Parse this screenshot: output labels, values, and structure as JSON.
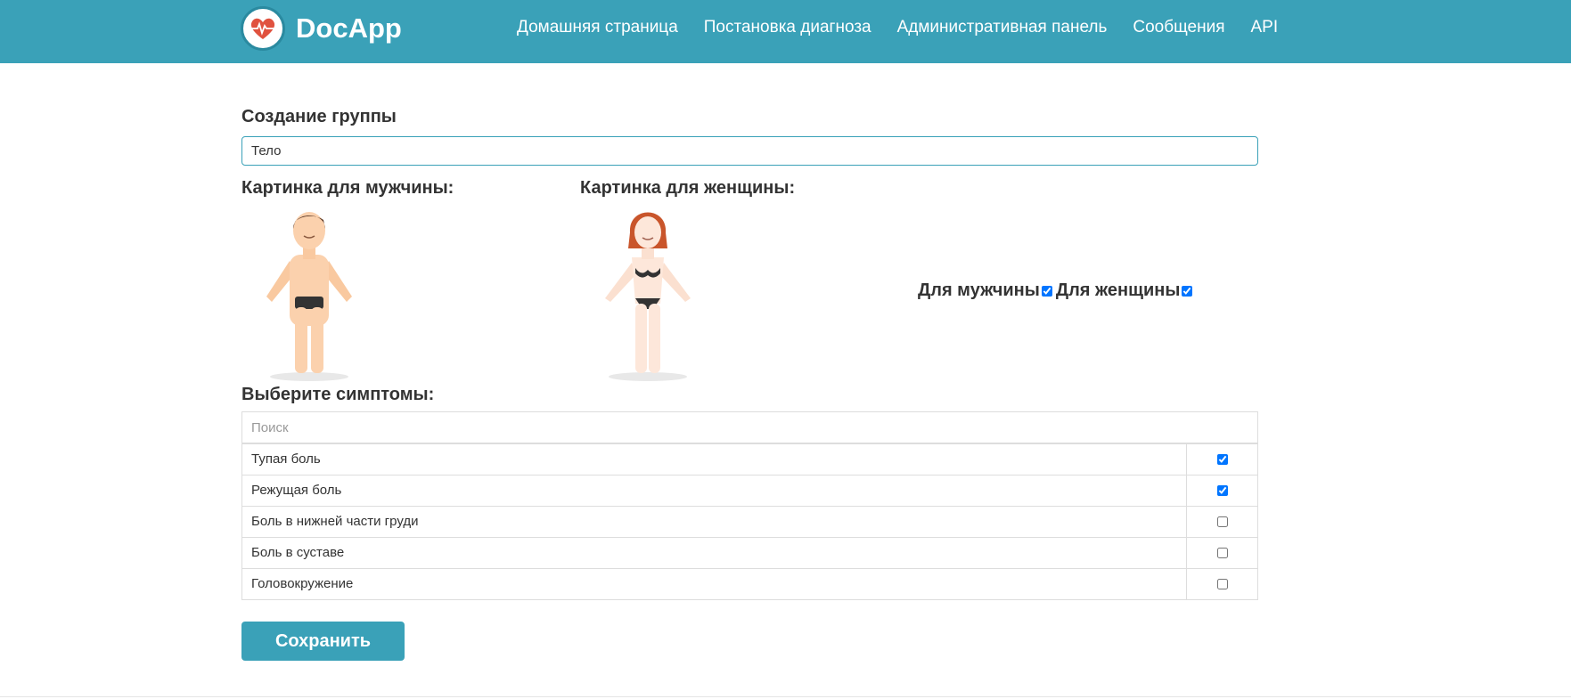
{
  "header": {
    "brand": "DocApp",
    "nav": [
      {
        "label": "Домашняя страница"
      },
      {
        "label": "Постановка диагноза"
      },
      {
        "label": "Административная панель"
      },
      {
        "label": "Сообщения"
      },
      {
        "label": "API"
      }
    ],
    "colors": {
      "navbar": "#3aa1b8",
      "logo_heart": "#e0523f"
    }
  },
  "form": {
    "title": "Создание группы",
    "group_name_value": "Тело",
    "male_image_label": "Картинка для мужчины:",
    "female_image_label": "Картинка для женщины:",
    "for_male_label": "Для мужчины",
    "for_male_checked": true,
    "for_female_label": "Для женщины",
    "for_female_checked": true,
    "symptoms_title": "Выберите симптомы:",
    "search_placeholder": "Поиск",
    "symptoms": [
      {
        "label": "Тупая боль",
        "checked": true
      },
      {
        "label": "Режущая боль",
        "checked": true
      },
      {
        "label": "Боль в нижней части груди",
        "checked": false
      },
      {
        "label": "Боль в суставе",
        "checked": false
      },
      {
        "label": "Головокружение",
        "checked": false
      }
    ],
    "save_label": "Сохранить"
  }
}
